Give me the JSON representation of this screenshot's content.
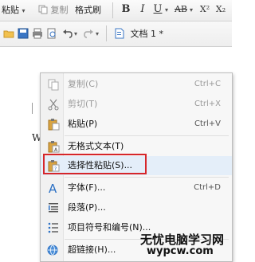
{
  "toolbar1": {
    "paste": "粘贴",
    "copy": "复制",
    "format_painter": "格式刷",
    "bold": "B",
    "italic": "I",
    "underline": "U",
    "strike": "AB",
    "superscript": "X²",
    "subscript": "X₂"
  },
  "toolbar2": {
    "doc_tab": "文档 1 *"
  },
  "doc": {
    "cursor_char": "W"
  },
  "menu": {
    "items": [
      {
        "label": "复制(C)",
        "shortcut": "Ctrl+C"
      },
      {
        "label": "剪切(T)",
        "shortcut": "Ctrl+X"
      },
      {
        "label": "粘贴(P)",
        "shortcut": "Ctrl+V"
      },
      {
        "label": "无格式文本(T)",
        "shortcut": ""
      },
      {
        "label": "选择性粘贴(S)...",
        "shortcut": ""
      },
      {
        "label": "字体(F)...",
        "shortcut": "Ctrl+D"
      },
      {
        "label": "段落(P)...",
        "shortcut": ""
      },
      {
        "label": "项目符号和编号(N)...",
        "shortcut": ""
      },
      {
        "label": "超链接(H)...",
        "shortcut": ""
      }
    ]
  },
  "watermark": {
    "line1": "无忧电脑学习网",
    "line2": "wypcw.com"
  },
  "colors": {
    "highlight_box": "#d6262a",
    "menu_bg": "#f7f7f7"
  }
}
